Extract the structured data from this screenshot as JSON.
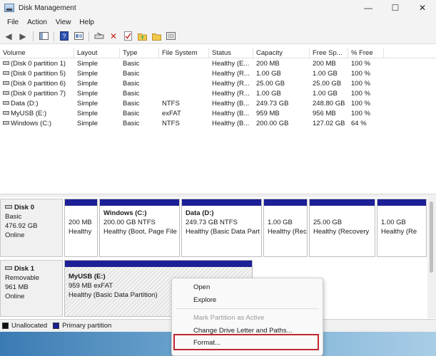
{
  "window": {
    "title": "Disk Management",
    "controls": {
      "minimize": "—",
      "maximize": "☐",
      "close": "✕"
    }
  },
  "menu": [
    "File",
    "Action",
    "View",
    "Help"
  ],
  "colors": {
    "primary_partition": "#1c1f96",
    "unallocated": "#111111",
    "highlight": "#c0282e"
  },
  "toolbar_icons": [
    "back-arrow-icon",
    "forward-arrow-icon",
    "show-hide-tree-icon",
    "help-icon",
    "properties-icon",
    "connect-icon",
    "delete-icon",
    "check-icon",
    "folder-up-icon",
    "folder-icon",
    "view-icon"
  ],
  "volume_list": {
    "columns": [
      "Volume",
      "Layout",
      "Type",
      "File System",
      "Status",
      "Capacity",
      "Free Sp...",
      "% Free"
    ],
    "rows": [
      [
        "(Disk 0 partition 1)",
        "Simple",
        "Basic",
        "",
        "Healthy (E...",
        "200 MB",
        "200 MB",
        "100 %"
      ],
      [
        "(Disk 0 partition 5)",
        "Simple",
        "Basic",
        "",
        "Healthy (R...",
        "1.00 GB",
        "1.00 GB",
        "100 %"
      ],
      [
        "(Disk 0 partition 6)",
        "Simple",
        "Basic",
        "",
        "Healthy (R...",
        "25.00 GB",
        "25.00 GB",
        "100 %"
      ],
      [
        "(Disk 0 partition 7)",
        "Simple",
        "Basic",
        "",
        "Healthy (R...",
        "1.00 GB",
        "1.00 GB",
        "100 %"
      ],
      [
        "Data (D:)",
        "Simple",
        "Basic",
        "NTFS",
        "Healthy (B...",
        "249.73 GB",
        "248.80 GB",
        "100 %"
      ],
      [
        "MyUSB (E:)",
        "Simple",
        "Basic",
        "exFAT",
        "Healthy (B...",
        "959 MB",
        "956 MB",
        "100 %"
      ],
      [
        "Windows (C:)",
        "Simple",
        "Basic",
        "NTFS",
        "Healthy (B...",
        "200.00 GB",
        "127.02 GB",
        "64 %"
      ]
    ]
  },
  "disks": [
    {
      "name": "Disk 0",
      "kind": "Basic",
      "size": "476.92 GB",
      "state": "Online",
      "partitions": [
        {
          "name": "",
          "line1": "200 MB",
          "line2": "Healthy"
        },
        {
          "name": "Windows  (C:)",
          "line1": "200.00 GB NTFS",
          "line2": "Healthy (Boot, Page File"
        },
        {
          "name": "Data  (D:)",
          "line1": "249.73 GB NTFS",
          "line2": "Healthy (Basic Data Part"
        },
        {
          "name": "",
          "line1": "1.00 GB",
          "line2": "Healthy (Rec"
        },
        {
          "name": "",
          "line1": "25.00 GB",
          "line2": "Healthy (Recovery"
        },
        {
          "name": "",
          "line1": "1.00 GB",
          "line2": "Healthy (Re"
        }
      ]
    },
    {
      "name": "Disk 1",
      "kind": "Removable",
      "size": "961 MB",
      "state": "Online",
      "partitions": [
        {
          "name": "MyUSB  (E:)",
          "line1": "959 MB exFAT",
          "line2": "Healthy (Basic Data Partition)"
        }
      ]
    }
  ],
  "legend": {
    "unallocated": "Unallocated",
    "primary": "Primary partition"
  },
  "context_menu": {
    "open": "Open",
    "explore": "Explore",
    "mark_active": "Mark Partition as Active",
    "change_letter": "Change Drive Letter and Paths...",
    "format": "Format..."
  }
}
